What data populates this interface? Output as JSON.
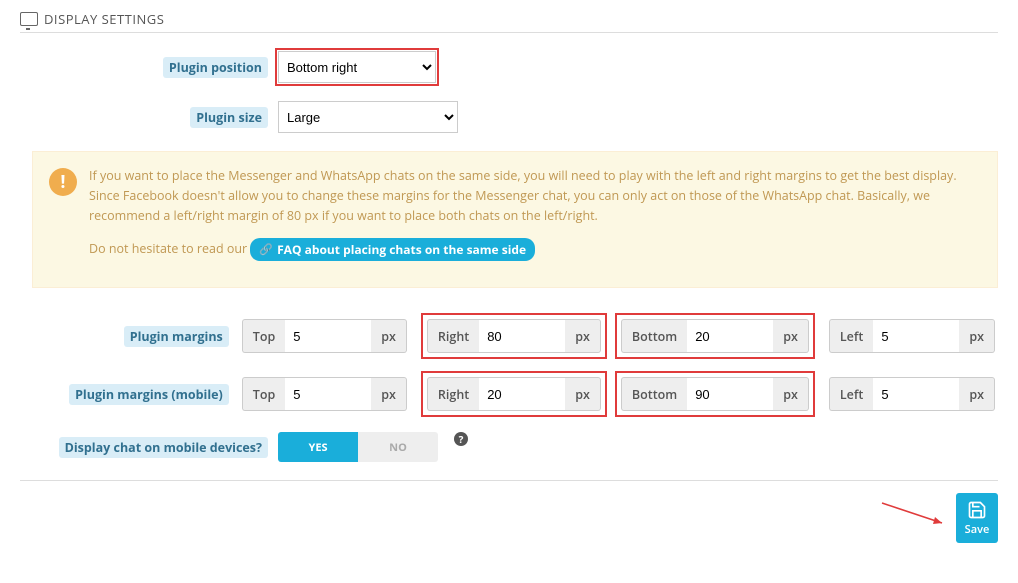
{
  "header": {
    "title": "DISPLAY SETTINGS"
  },
  "rows": {
    "position": {
      "label": "Plugin position",
      "value": "Bottom right"
    },
    "size": {
      "label": "Plugin size",
      "value": "Large"
    },
    "margins": {
      "label": "Plugin margins"
    },
    "margins_mobile": {
      "label": "Plugin margins (mobile)"
    },
    "display_mobile": {
      "label": "Display chat on mobile devices?",
      "yes": "YES",
      "no": "NO"
    }
  },
  "alert": {
    "text": "If you want to place the Messenger and WhatsApp chats on the same side, you will need to play with the left and right margins to get the best display. Since Facebook doesn't allow you to change these margins for the Messenger chat, you can only act on those of the WhatsApp chat. Basically, we recommend a left/right margin of 80 px if you want to place both chats on the left/right.",
    "readour": "Do not hesitate to read our",
    "faq": "FAQ about placing chats on the same side"
  },
  "margins": {
    "desktop": {
      "top": "5",
      "right": "80",
      "bottom": "20",
      "left": "5"
    },
    "mobile": {
      "top": "5",
      "right": "20",
      "bottom": "90",
      "left": "5"
    }
  },
  "units": {
    "px": "px",
    "top": "Top",
    "right": "Right",
    "bottom": "Bottom",
    "left": "Left"
  },
  "save": "Save"
}
